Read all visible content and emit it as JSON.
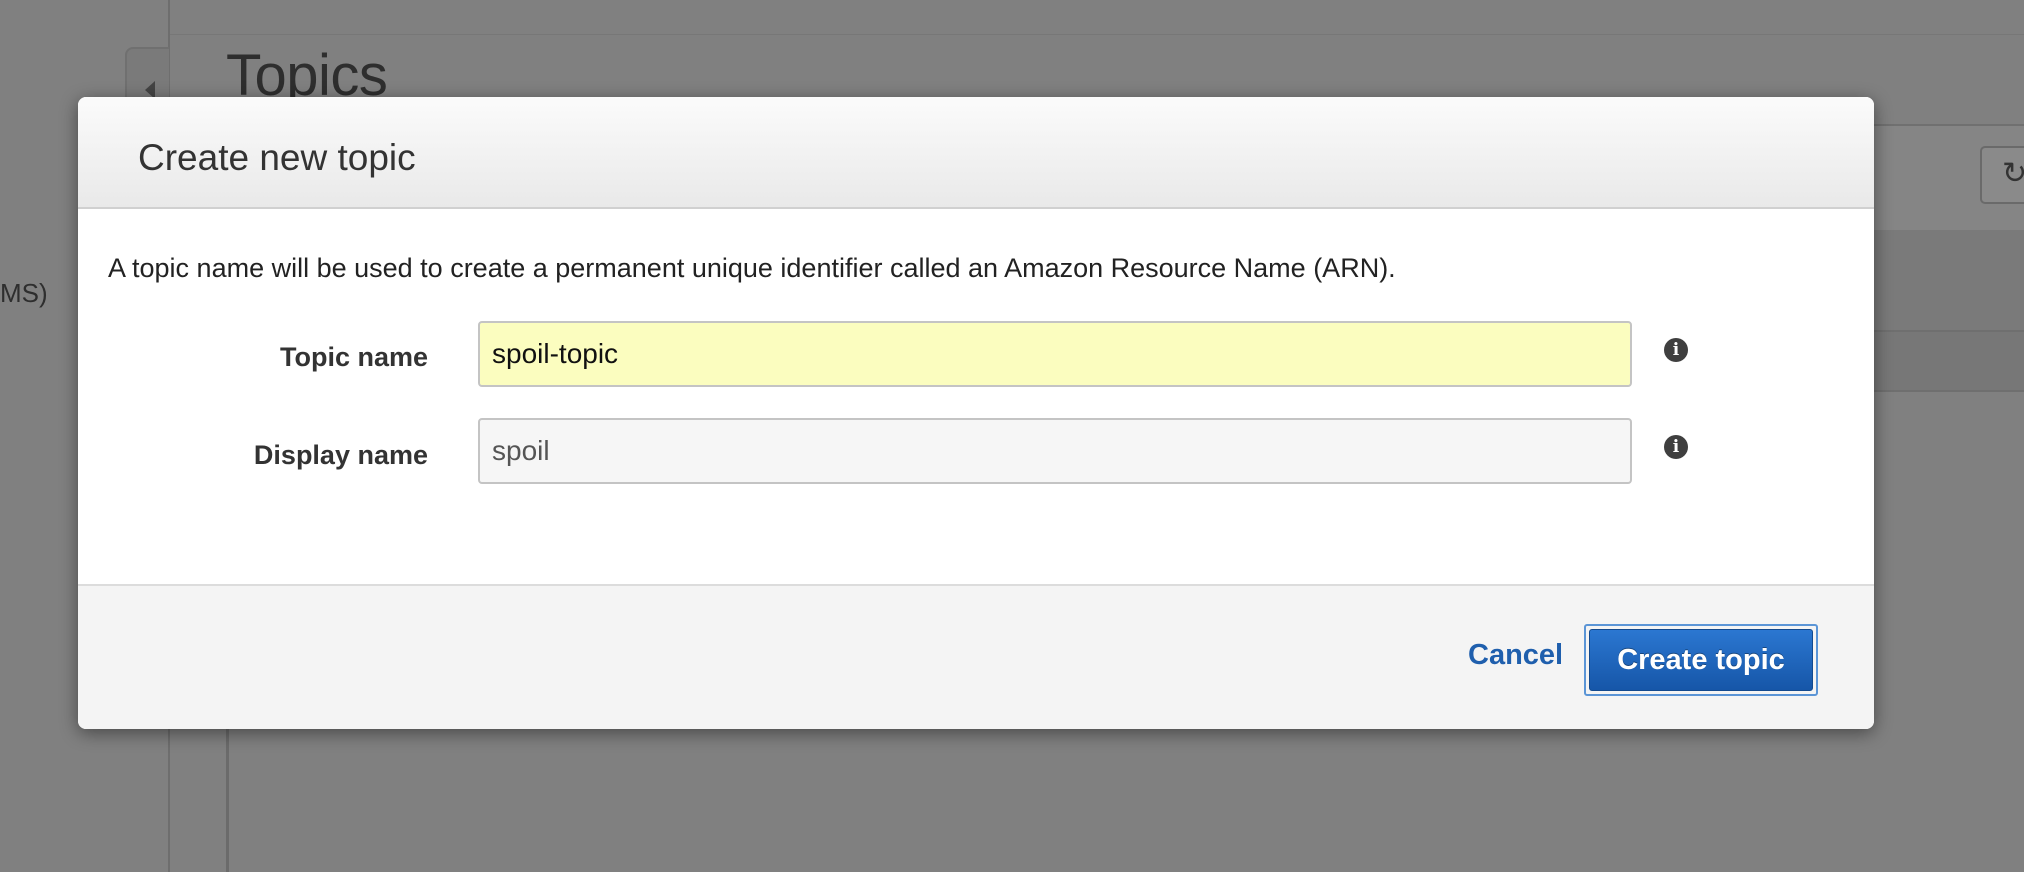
{
  "background": {
    "page_title": "Topics",
    "sidebar_partial_text": "MS)",
    "refresh_icon": "refresh-icon"
  },
  "dialog": {
    "title": "Create new topic",
    "description": "A topic name will be used to create a permanent unique identifier called an Amazon Resource Name (ARN).",
    "fields": [
      {
        "label": "Topic name",
        "value": "spoil-topic",
        "highlight_color": "#fbfdbf",
        "help_icon": "info-icon"
      },
      {
        "label": "Display name",
        "value": "spoil",
        "help_icon": "info-icon"
      }
    ],
    "actions": {
      "cancel_label": "Cancel",
      "submit_label": "Create topic"
    }
  },
  "colors": {
    "overlay": "#808080",
    "primary_button": "#1f66bf",
    "link": "#1f5fad"
  }
}
